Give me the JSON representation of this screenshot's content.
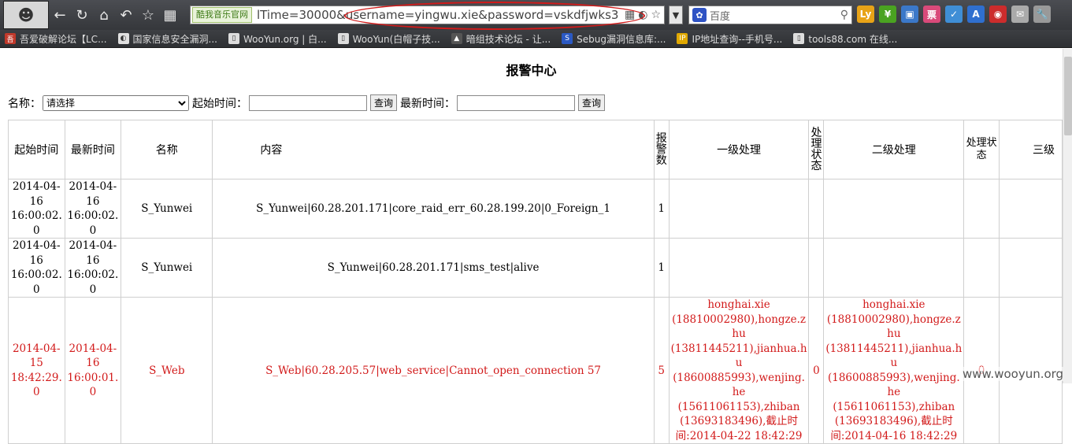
{
  "browser": {
    "back_glyph": "←",
    "reload_glyph": "↻",
    "home_glyph": "⌂",
    "undo_glyph": "↶",
    "star_glyph": "☆",
    "apps_glyph": "▦",
    "site_badge": "酷我音乐官网",
    "url": "lTime=30000&username=yingwu.xie&password=vskdfjwks3",
    "search_placeholder": "百度",
    "extensions": [
      {
        "label": "Ly",
        "color": "#e8a317"
      },
      {
        "label": "¥",
        "color": "#4aa321"
      },
      {
        "label": "▣",
        "color": "#3b78c9"
      },
      {
        "label": "票",
        "color": "#d94a7a"
      },
      {
        "label": "✓",
        "color": "#3f8ed6"
      },
      {
        "label": "A",
        "color": "#2f6fcf"
      },
      {
        "label": "◉",
        "color": "#cc2c2c"
      },
      {
        "label": "✉",
        "color": "#aaaaaa"
      },
      {
        "label": "🔧",
        "color": "#999999"
      }
    ]
  },
  "bookmarks": [
    {
      "label": "吾爱破解论坛【LC...",
      "icon_color": "#c0392b",
      "icon": "吾"
    },
    {
      "label": "国家信息安全漏洞...",
      "icon_color": "#e0e0e0",
      "icon": "◐"
    },
    {
      "label": "WooYun.org | 白...",
      "icon_color": "#dddddd",
      "icon": "▯"
    },
    {
      "label": "WooYun(白帽子技...",
      "icon_color": "#dddddd",
      "icon": "▯"
    },
    {
      "label": "暗组技术论坛 - 让...",
      "icon_color": "#555555",
      "icon": "▲"
    },
    {
      "label": "Sebug漏洞信息库:...",
      "icon_color": "#2b59c3",
      "icon": "S"
    },
    {
      "label": "IP地址查询--手机号...",
      "icon_color": "#e0a800",
      "icon": "IP"
    },
    {
      "label": "tools88.com 在线...",
      "icon_color": "#dddddd",
      "icon": "▯"
    }
  ],
  "page": {
    "title": "报警中心",
    "filter": {
      "name_label": "名称：",
      "name_selected": "请选择",
      "start_label": "起始时间：",
      "query_button": "查询",
      "latest_label": "最新时间：",
      "query_button_2": "查询"
    },
    "table": {
      "headers": [
        "起始时间",
        "最新时间",
        "名称",
        "内容",
        "报警数",
        "一级处理",
        "处理状态",
        "二级处理",
        "处理状态",
        "三级"
      ],
      "rows": [
        {
          "start": "2014-04-16 16:00:02.0",
          "latest": "2014-04-16 16:00:02.0",
          "name": "S_Yunwei",
          "content": "S_Yunwei|60.28.201.171|core_raid_err_60.28.199.20|0_Foreign_1",
          "count": "1",
          "level1": "",
          "status1": "",
          "level2": "",
          "status2": "",
          "level3": "",
          "red": false
        },
        {
          "start": "2014-04-16 16:00:02.0",
          "latest": "2014-04-16 16:00:02.0",
          "name": "S_Yunwei",
          "content": "S_Yunwei|60.28.201.171|sms_test|alive",
          "count": "1",
          "level1": "",
          "status1": "",
          "level2": "",
          "status2": "",
          "level3": "",
          "red": false
        },
        {
          "start": "2014-04-15 18:42:29.0",
          "latest": "2014-04-16 16:00:01.0",
          "name": "S_Web",
          "content": "S_Web|60.28.205.57|web_service|Cannot_open_connection 57",
          "count": "5",
          "level1": "honghai.xie (18810002980),hongze.zhu (13811445211),jianhua.hu (18600885993),wenjing.he (15611061153),zhiban (13693183496),截止时间:2014-04-22 18:42:29",
          "status1": "0",
          "level2": "honghai.xie (18810002980),hongze.zhu (13811445211),jianhua.hu (18600885993),wenjing.he (15611061153),zhiban (13693183496),截止时间:2014-04-16 18:42:29",
          "status2": "0",
          "level3": "",
          "red": true
        }
      ]
    }
  },
  "watermark": "www.wooyun.org"
}
